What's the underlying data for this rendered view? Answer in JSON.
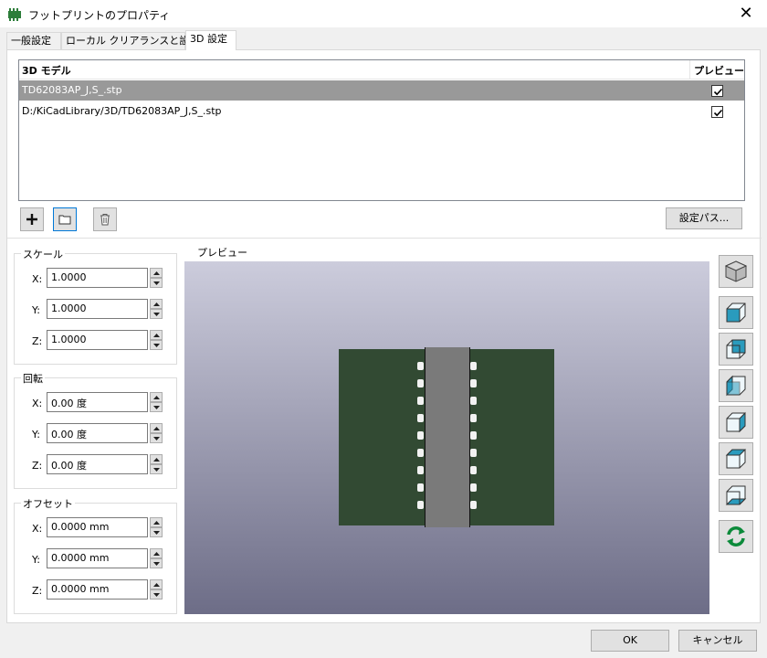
{
  "window": {
    "title": "フットプリントのプロパティ",
    "close_label": "✕"
  },
  "tabs": [
    {
      "label": "一般設定"
    },
    {
      "label": "ローカル クリアランスと設定"
    },
    {
      "label": "3D 設定"
    }
  ],
  "model_list": {
    "col_model": "3D モデル",
    "col_preview": "プレビュー",
    "rows": [
      {
        "path": "TD62083AP_J,S_.stp",
        "preview": true,
        "selected": true
      },
      {
        "path": "D:/KiCadLibrary/3D/TD62083AP_J,S_.stp",
        "preview": true,
        "selected": false
      }
    ]
  },
  "toolbar": {
    "add_icon": "plus-icon",
    "browse_icon": "folder-icon",
    "delete_icon": "trash-icon",
    "settings_path_label": "設定パス..."
  },
  "scale": {
    "title": "スケール",
    "x_label": "X:",
    "x": "1.0000",
    "y_label": "Y:",
    "y": "1.0000",
    "z_label": "Z:",
    "z": "1.0000"
  },
  "rotation": {
    "title": "回転",
    "x_label": "X:",
    "x": "0.00 度",
    "y_label": "Y:",
    "y": "0.00 度",
    "z_label": "Z:",
    "z": "0.00 度"
  },
  "offset": {
    "title": "オフセット",
    "x_label": "X:",
    "x": "0.0000 mm",
    "y_label": "Y:",
    "y": "0.0000 mm",
    "z_label": "Z:",
    "z": "0.0000 mm"
  },
  "preview": {
    "label": "プレビュー"
  },
  "view_buttons": [
    "view-3d-icon",
    "view-front-icon",
    "view-back-icon",
    "view-left-icon",
    "view-right-icon",
    "view-top-icon",
    "view-bottom-icon",
    "reload-icon"
  ],
  "footer": {
    "ok_label": "OK",
    "cancel_label": "キャンセル"
  }
}
